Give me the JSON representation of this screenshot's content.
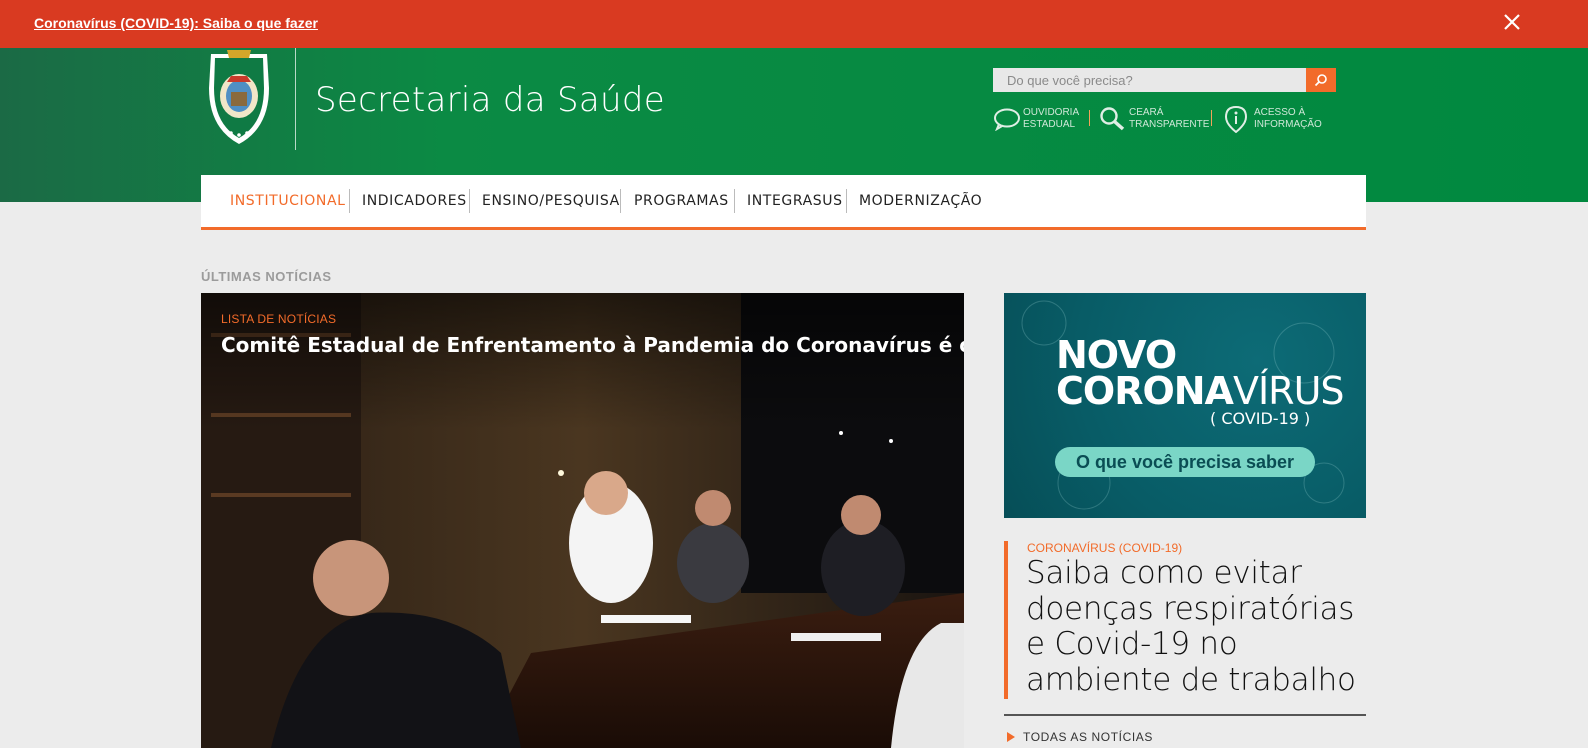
{
  "alert": {
    "link_text": "Coronavírus (COVID-19): Saiba o que fazer"
  },
  "header": {
    "title": "Secretaria da Saúde",
    "search_placeholder": "Do que você precisa?",
    "quick_links": [
      {
        "line1": "OUVIDORIA",
        "line2": "ESTADUAL",
        "icon": "speech-bubble-icon"
      },
      {
        "line1": "CEARÁ",
        "line2": "TRANSPARENTE",
        "icon": "magnifier-icon"
      },
      {
        "line1": "ACESSO À",
        "line2": "INFORMAÇÃO",
        "icon": "info-pin-icon"
      }
    ]
  },
  "nav": {
    "items": [
      {
        "label": "INSTITUCIONAL",
        "active": true
      },
      {
        "label": "INDICADORES"
      },
      {
        "label": "ENSINO/PESQUISA"
      },
      {
        "label": "PROGRAMAS"
      },
      {
        "label": "INTEGRASUS"
      },
      {
        "label": "MODERNIZAÇÃO"
      }
    ]
  },
  "main": {
    "section_label": "ÚLTIMAS NOTÍCIAS",
    "hero": {
      "kicker": "LISTA DE NOTÍCIAS",
      "title": "Comitê Estadual de Enfrentamento à Pandemia do Coronavírus é criado no Ceará"
    },
    "banner": {
      "line1": "NOVO",
      "line2_bold": "CORONA",
      "line2_light": "VÍRUS",
      "sub": "( COVID-19 )",
      "pill": "O que você precisa saber"
    },
    "side_news": {
      "kicker": "CORONAVÍRUS (COVID-19)",
      "title": "Saiba como evitar doenças respiratórias e Covid-19 no ambiente de trabalho"
    },
    "all_news_label": "TODAS AS NOTÍCIAS"
  },
  "colors": {
    "alert_red": "#d93a21",
    "header_green": "#00893f",
    "accent_orange": "#f26b2a",
    "banner_teal": "#085c66"
  }
}
